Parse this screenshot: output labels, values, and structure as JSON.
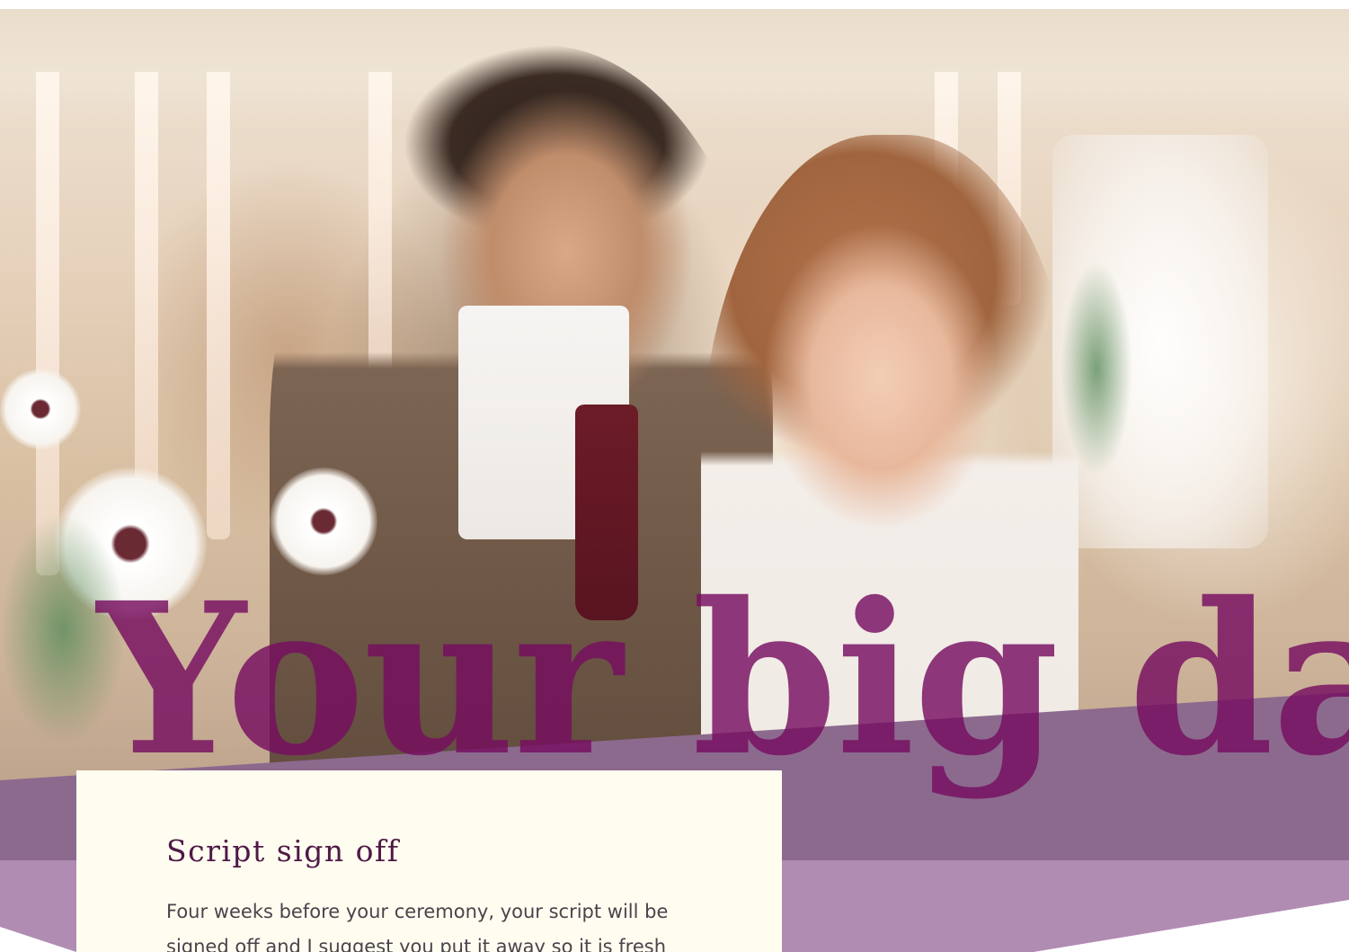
{
  "hero": {
    "title": "Your big day"
  },
  "card": {
    "title": "Script sign off",
    "text": "Four weeks before your ceremony, your script will be signed off and I suggest you put it away so it is fresh"
  },
  "colors": {
    "title_purple": "#760e60",
    "band_dark": "#8c6a8e",
    "band_light": "#b08cb2",
    "card_bg": "#fffdf0",
    "card_title": "#4f1946",
    "card_text": "#4a434b"
  }
}
